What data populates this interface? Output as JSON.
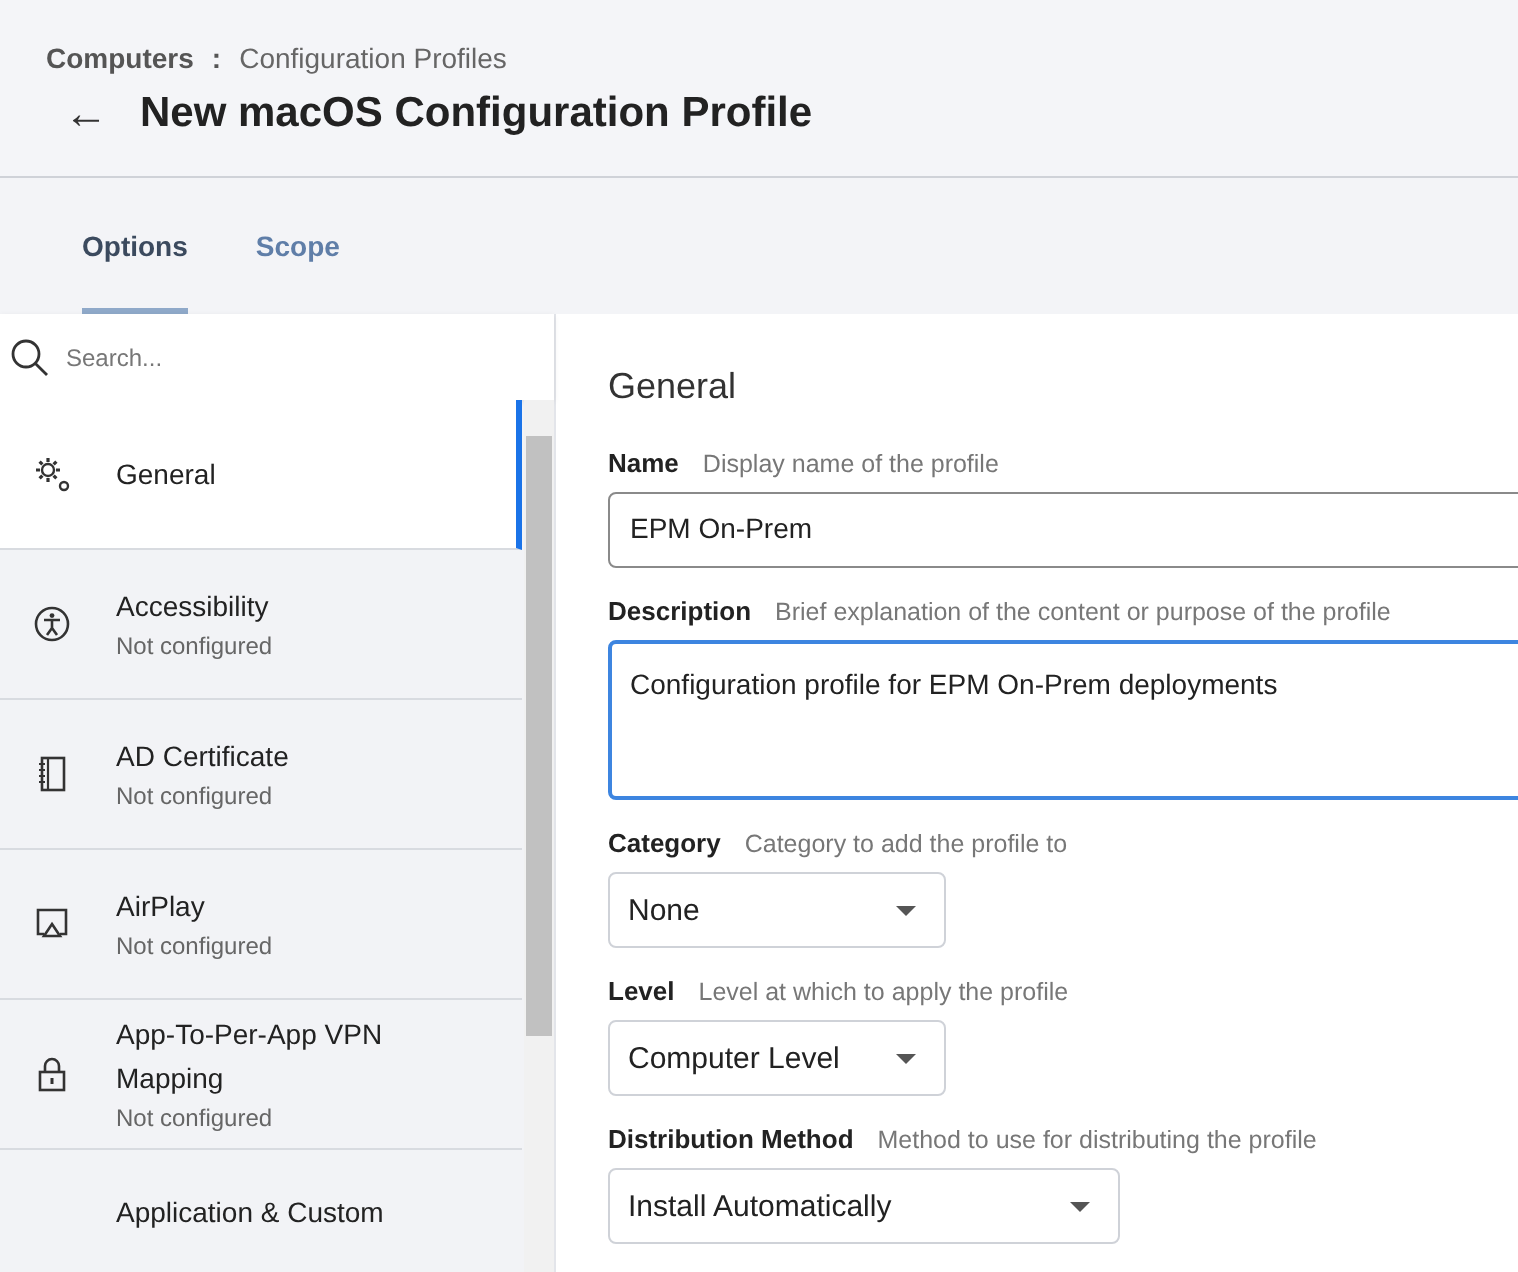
{
  "breadcrumb": {
    "parent": "Computers",
    "separator": ":",
    "current": "Configuration Profiles"
  },
  "page_title": {
    "back": "←",
    "title": "New macOS Configuration Profile"
  },
  "tabs": [
    {
      "label": "Options",
      "selected": true
    },
    {
      "label": "Scope",
      "selected": false
    }
  ],
  "sidebar": {
    "search": {
      "placeholder": "Search..."
    },
    "items": [
      {
        "label": "General",
        "selected": true
      },
      {
        "label": "Accessibility",
        "status": "Not configured",
        "selected": false
      },
      {
        "label": "AD Certificate",
        "status": "Not configured",
        "selected": false
      },
      {
        "label": "AirPlay",
        "status": "Not configured",
        "selected": false
      },
      {
        "label": "App-To-Per-App VPN Mapping",
        "status": "Not configured",
        "selected": false
      },
      {
        "label": "Application & Custom",
        "selected": false
      }
    ]
  },
  "form": {
    "heading": "General",
    "fields": [
      {
        "kind": "text",
        "label": "Name",
        "hint": "Display name of the profile",
        "value": "EPM On-Prem",
        "focused": false
      },
      {
        "kind": "textarea",
        "label": "Description",
        "hint": "Brief explanation of the content or purpose of the profile",
        "value": "Configuration profile for EPM On-Prem deployments",
        "focused": true
      },
      {
        "kind": "select",
        "label": "Category",
        "hint": "Category to add the profile to",
        "value": "None",
        "focused": false
      },
      {
        "kind": "select",
        "label": "Level",
        "hint": "Level at which to apply the profile",
        "value": "Computer Level",
        "focused": false
      },
      {
        "kind": "select",
        "label": "Distribution Method",
        "hint": "Method to use for distributing the profile",
        "value": "Install Automatically",
        "focused": false
      }
    ]
  }
}
